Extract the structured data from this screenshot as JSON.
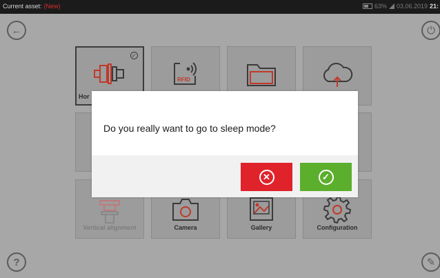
{
  "status_bar": {
    "current_asset_label": "Current asset:",
    "current_asset_value": "(New)",
    "battery_percent": "63%",
    "date": "03.06.2019",
    "time": "21:"
  },
  "buttons": {
    "back": "←",
    "power": "⏻",
    "help": "?",
    "edit": "✎"
  },
  "tiles": [
    {
      "label": "Hor",
      "icon": "horizontal-alignment-icon"
    },
    {
      "label": "",
      "icon": "rfid-icon",
      "icon_text": "RFID"
    },
    {
      "label": "",
      "icon": "folder-icon"
    },
    {
      "label": "",
      "icon": "cloud-upload-icon"
    },
    {
      "label": "Vertical alignment",
      "icon": "vertical-alignment-icon"
    },
    {
      "label": "Camera",
      "icon": "camera-icon"
    },
    {
      "label": "Gallery",
      "icon": "gallery-icon"
    },
    {
      "label": "Configuration",
      "icon": "gear-icon"
    }
  ],
  "dialog": {
    "message": "Do you really want to go to sleep mode?",
    "cancel_symbol": "✕",
    "confirm_symbol": "✓"
  },
  "colors": {
    "accent_red": "#e0232b",
    "accent_green": "#5cae2d",
    "icon_red": "#c0392b"
  }
}
